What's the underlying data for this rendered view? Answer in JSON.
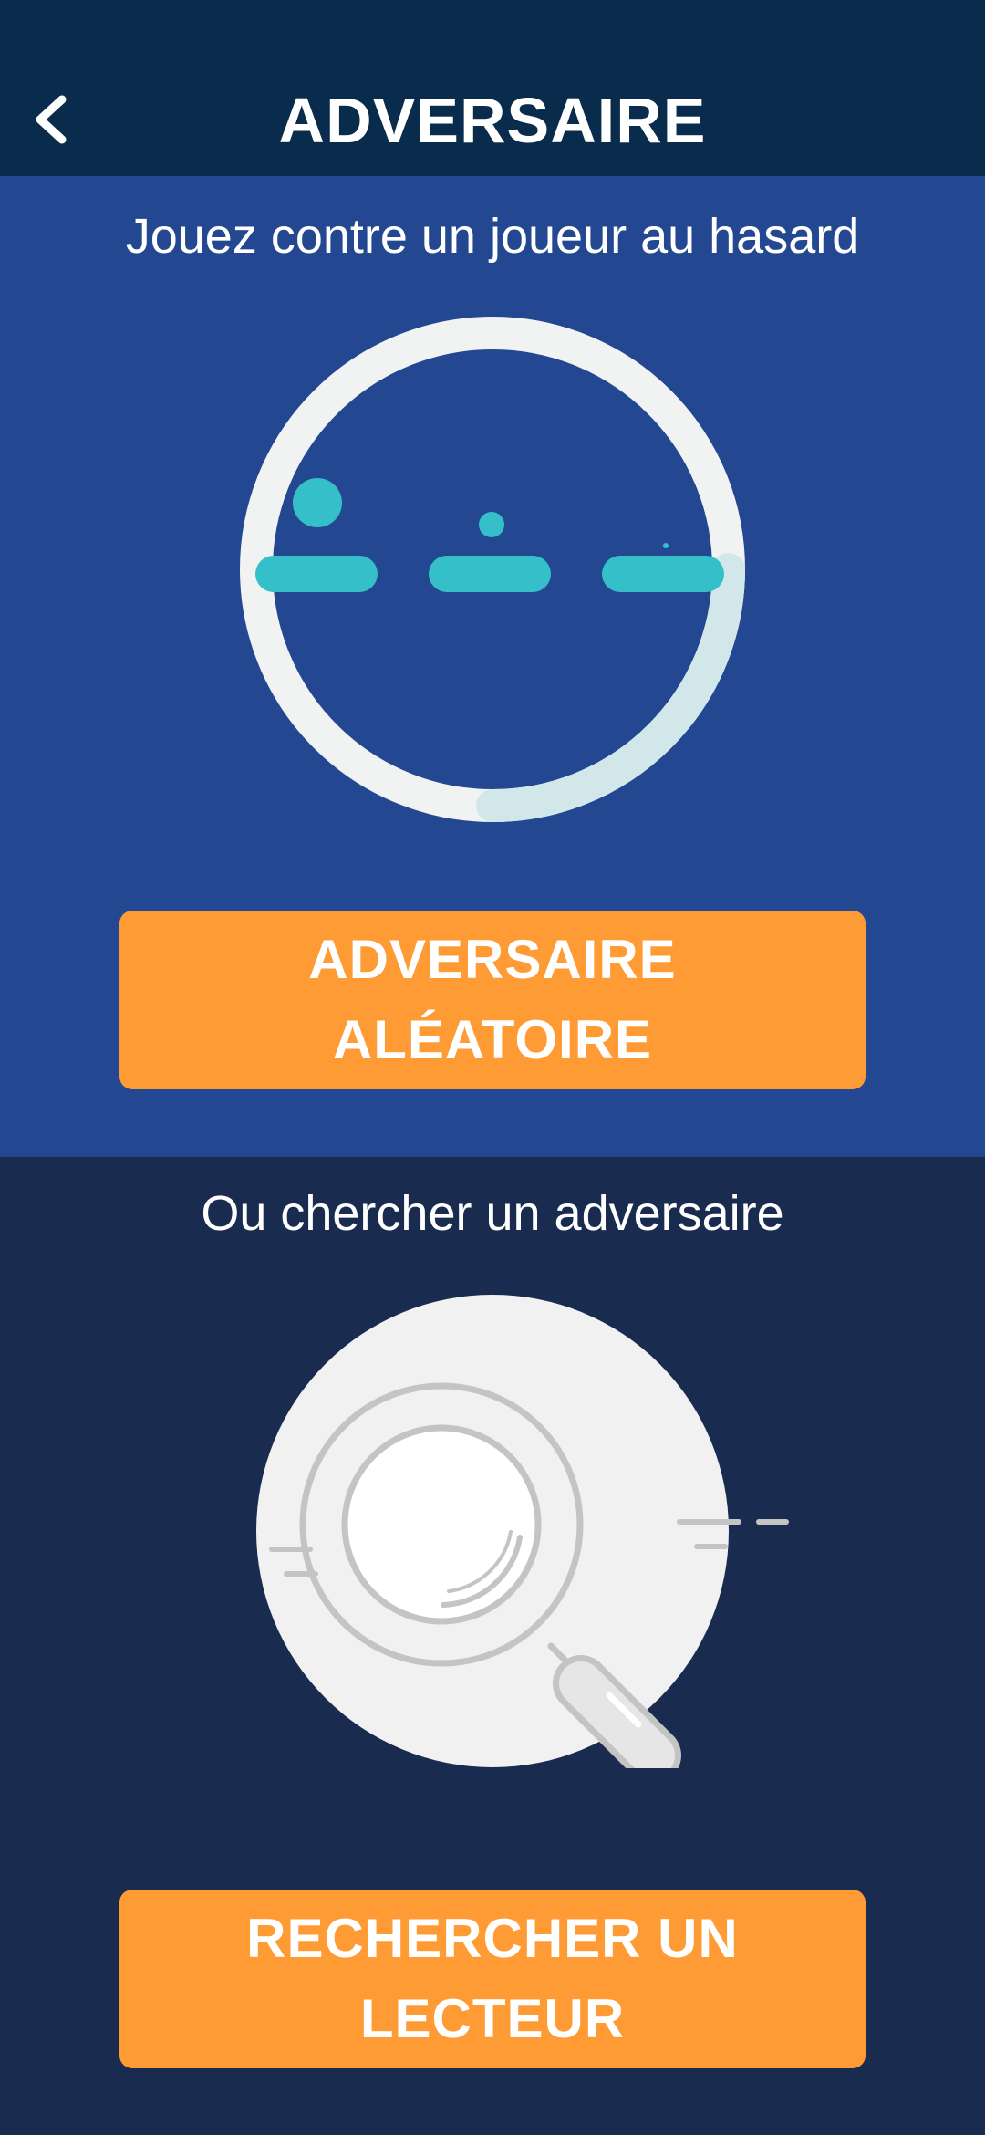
{
  "header": {
    "title": "ADVERSAIRE",
    "back_icon": "chevron-left-icon"
  },
  "random": {
    "heading": "Jouez contre un joueur au hasard",
    "button_line1": "ADVERSAIRE",
    "button_line2": "ALÉATOIRE",
    "illustration_icon": "matchmaking-loader-icon",
    "loader_progress": 0.28
  },
  "search": {
    "heading": "Ou chercher un adversaire",
    "button_line1": "RECHERCHER UN",
    "button_line2": "LECTEUR",
    "illustration_icon": "magnifying-glass-icon"
  },
  "colors": {
    "header_bg": "#0a2c4c",
    "top_section_bg": "#234891",
    "bottom_section_bg": "#1a2b50",
    "button_bg": "#ff9b35",
    "accent_teal": "#35bfc9"
  }
}
